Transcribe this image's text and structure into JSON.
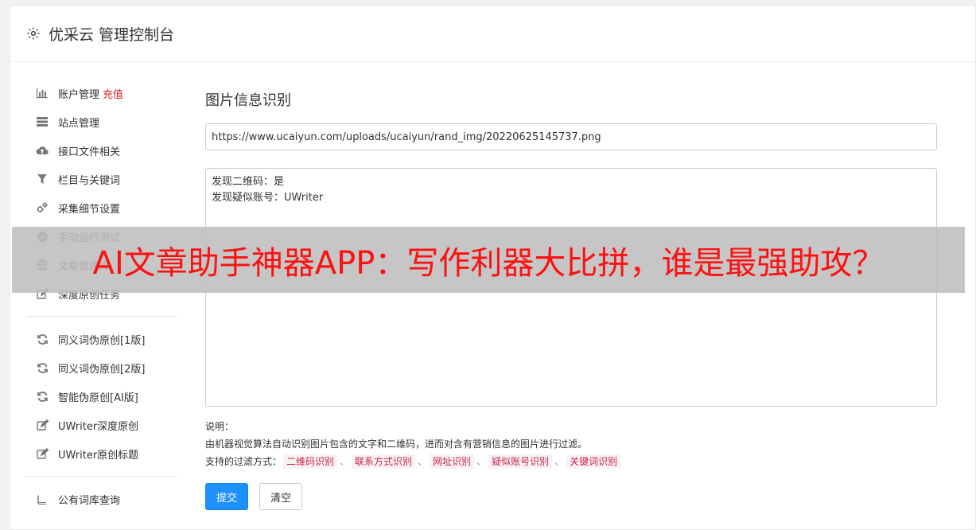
{
  "header": {
    "title": "优采云 管理控制台",
    "icon": "gear-icon"
  },
  "sidebar": {
    "group1": [
      {
        "label": "账户管理",
        "badge": "充值",
        "icon": "bar-chart-icon"
      },
      {
        "label": "站点管理",
        "icon": "server-icon"
      },
      {
        "label": "接口文件相关",
        "icon": "cloud-upload-icon"
      },
      {
        "label": "栏目与关键词",
        "icon": "filter-icon"
      },
      {
        "label": "采集细节设置",
        "icon": "cogs-icon"
      },
      {
        "label": "手动运行测试",
        "icon": "play-circle-icon"
      },
      {
        "label": "文章管理库",
        "icon": "database-icon"
      },
      {
        "label": "深度原创任务",
        "icon": "edit-icon"
      }
    ],
    "group2": [
      {
        "label": "同义词伪原创[1版]",
        "icon": "refresh-icon"
      },
      {
        "label": "同义词伪原创[2版]",
        "icon": "refresh-icon"
      },
      {
        "label": "智能伪原创[AI版]",
        "icon": "refresh-icon"
      },
      {
        "label": "UWriter深度原创",
        "icon": "edit-icon"
      },
      {
        "label": "UWriter原创标题",
        "icon": "edit-icon"
      }
    ],
    "group3": [
      {
        "label": "公有词库查询",
        "icon": "book-icon"
      }
    ]
  },
  "main": {
    "title": "图片信息识别",
    "url_value": "https://www.ucaiyun.com/uploads/ucaiyun/rand_img/20220625145737.png",
    "result_lines": [
      "发现二维码：是",
      "发现疑似账号：UWriter"
    ],
    "notes_title": "说明：",
    "notes_desc": "由机器视觉算法自动识别图片包含的文字和二维码，进而对含有营销信息的图片进行过滤。",
    "filter_label": "支持的过滤方式：",
    "filters": [
      "二维码识别",
      "联系方式识别",
      "网址识别",
      "疑似账号识别",
      "关键词识别"
    ],
    "filter_separator": "、",
    "submit_label": "提交",
    "clear_label": "清空"
  },
  "overlay": {
    "text": "AI文章助手神器APP：写作利器大比拼，谁是最强助攻？"
  },
  "colors": {
    "primary": "#1e90ff",
    "badge": "#e02020",
    "tag_text": "#c7254e",
    "tag_bg": "#f9f2f4",
    "overlay_text": "#ff1010"
  }
}
